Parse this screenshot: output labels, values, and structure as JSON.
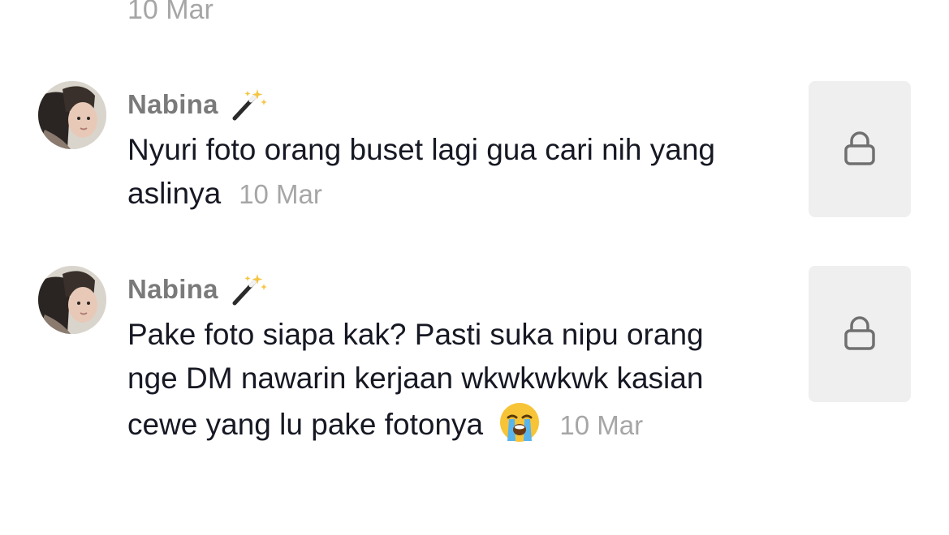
{
  "previous_comment": {
    "date": "10 Mar"
  },
  "comments": [
    {
      "author": "Nabina",
      "author_badge_icon": "magic-wand-icon",
      "text": "Nyuri foto orang buset lagi gua cari nih yang aslinya",
      "date": "10 Mar",
      "attached_video_icon": "lock-icon"
    },
    {
      "author": "Nabina",
      "author_badge_icon": "magic-wand-icon",
      "text": "Pake foto siapa kak? Pasti suka nipu orang nge DM nawarin kerjaan wkwkwkwk kasian cewe yang lu pake fotonya",
      "emoji": "😭",
      "date": "10 Mar",
      "attached_video_icon": "lock-icon"
    }
  ],
  "colors": {
    "name": "#7a7a7a",
    "text": "#161823",
    "date": "#a6a6a6",
    "thumb_bg": "#efefef"
  }
}
